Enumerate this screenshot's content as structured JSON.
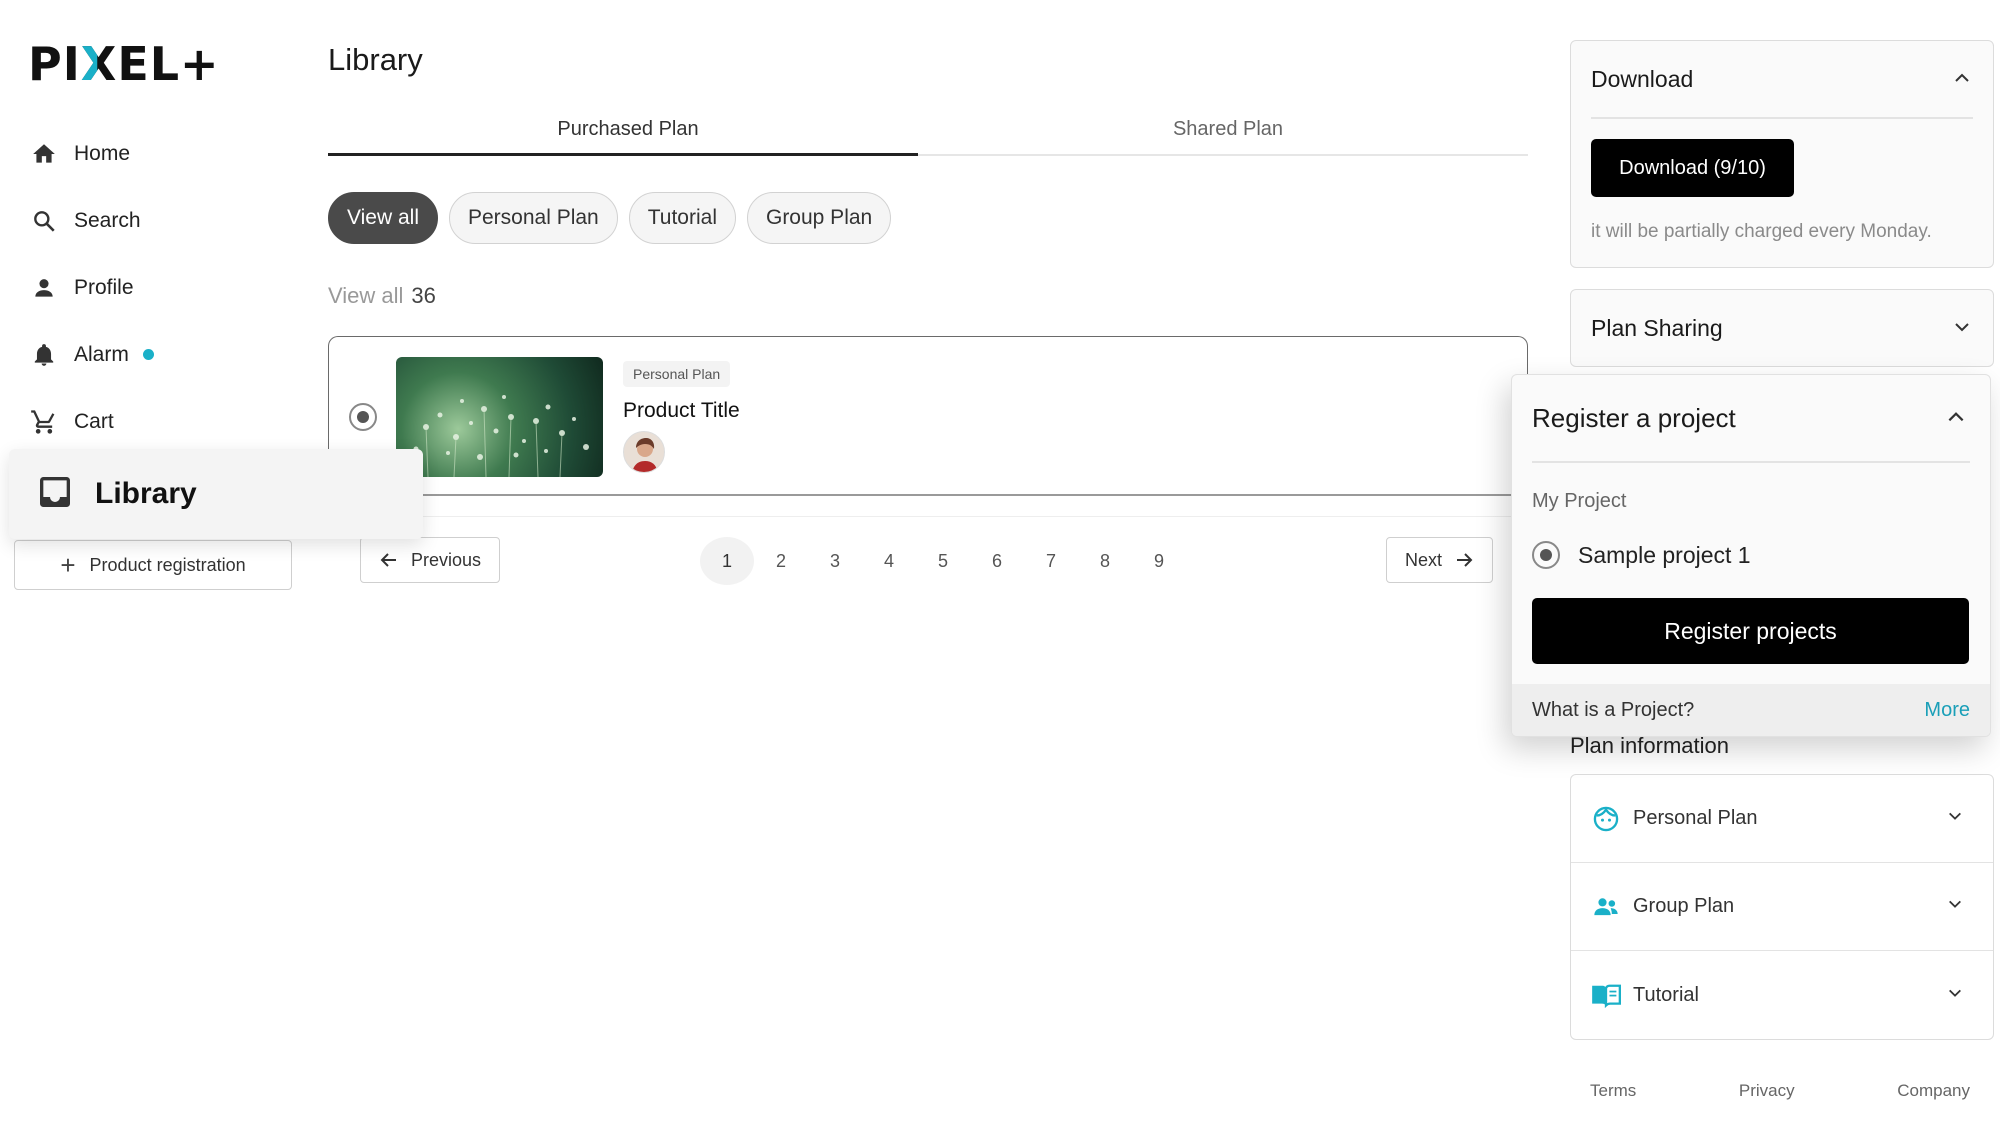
{
  "brand": {
    "logo_pre": "PI",
    "logo_x": "X",
    "logo_post": "EL+"
  },
  "sidebar": {
    "items": [
      {
        "label": "Home",
        "icon": "home-icon"
      },
      {
        "label": "Search",
        "icon": "search-icon"
      },
      {
        "label": "Profile",
        "icon": "person-icon"
      },
      {
        "label": "Alarm",
        "icon": "bell-icon",
        "badge_color": "#1ab0c8"
      },
      {
        "label": "Cart",
        "icon": "cart-icon"
      }
    ],
    "active": {
      "label": "Library",
      "icon": "inbox-icon"
    },
    "product_registration": "Product registration"
  },
  "main": {
    "title": "Library",
    "tabs": [
      {
        "label": "Purchased Plan",
        "active": true
      },
      {
        "label": "Shared Plan",
        "active": false
      }
    ],
    "filters": [
      {
        "label": "View all",
        "selected": true
      },
      {
        "label": "Personal Plan",
        "selected": false
      },
      {
        "label": "Tutorial",
        "selected": false
      },
      {
        "label": "Group Plan",
        "selected": false
      }
    ],
    "count_label": "View all",
    "count_value": "36",
    "card": {
      "tag": "Personal Plan",
      "title": "Product Title",
      "selected": true
    },
    "pagination": {
      "previous": "Previous",
      "next": "Next",
      "pages": [
        "1",
        "2",
        "3",
        "4",
        "5",
        "6",
        "7",
        "8",
        "9"
      ],
      "current": "1"
    }
  },
  "right": {
    "download": {
      "title": "Download",
      "button": "Download (9/10)",
      "note": "it will be partially charged every Monday."
    },
    "sharing": {
      "title": "Plan Sharing"
    },
    "register": {
      "title": "Register a project",
      "subtitle": "My Project",
      "option": "Sample project 1",
      "button": "Register projects",
      "footer_question": "What is a Project?",
      "footer_more": "More"
    },
    "plan_info": {
      "title": "Plan information",
      "items": [
        {
          "label": "Personal Plan",
          "icon": "smiley-icon"
        },
        {
          "label": "Group Plan",
          "icon": "group-icon"
        },
        {
          "label": "Tutorial",
          "icon": "book-icon"
        }
      ]
    },
    "footer_links": [
      "Terms",
      "Privacy",
      "Company"
    ]
  },
  "colors": {
    "accent": "#1ab0c8",
    "primary_button": "#000000",
    "selected_chip": "#4a4a4a"
  }
}
